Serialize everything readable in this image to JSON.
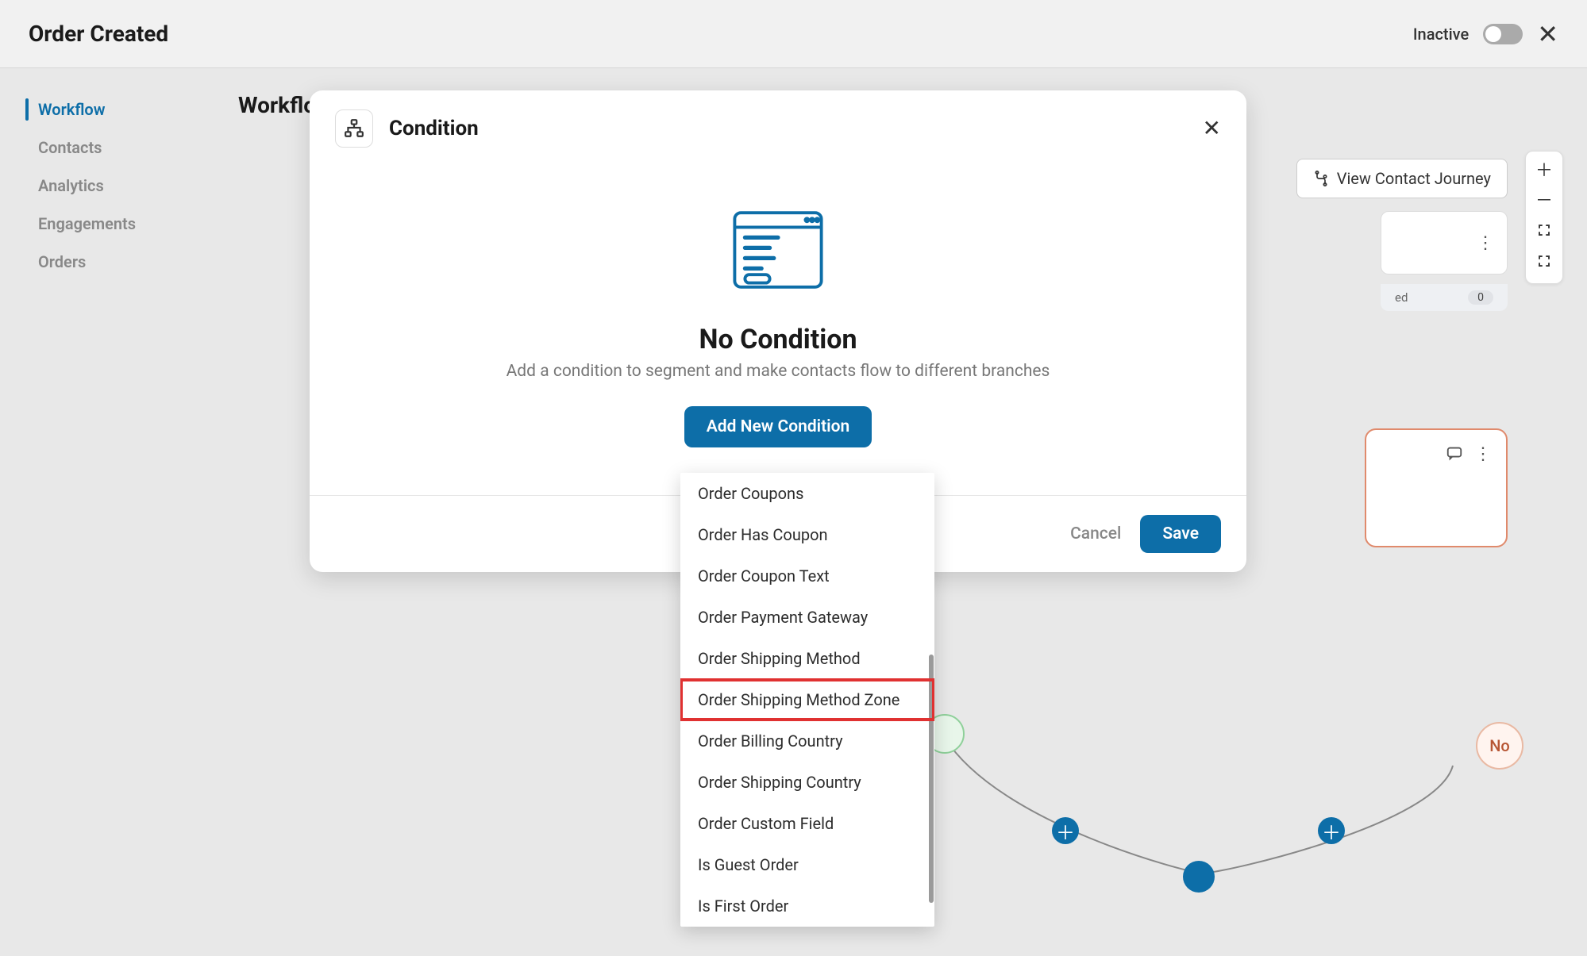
{
  "header": {
    "title": "Order Created",
    "status": "Inactive"
  },
  "sidebar": {
    "items": [
      {
        "label": "Workflow",
        "active": true
      },
      {
        "label": "Contacts",
        "active": false
      },
      {
        "label": "Analytics",
        "active": false
      },
      {
        "label": "Engagements",
        "active": false
      },
      {
        "label": "Orders",
        "active": false
      }
    ]
  },
  "content": {
    "title": "Workflow",
    "journey_button": "View Contact Journey"
  },
  "background": {
    "badge_label": "ed",
    "badge_count": "0",
    "node_no": "No"
  },
  "modal": {
    "title": "Condition",
    "empty_title": "No Condition",
    "empty_sub": "Add a condition to segment and make contacts flow to different branches",
    "add_button": "Add New Condition",
    "cancel": "Cancel",
    "save": "Save"
  },
  "dropdown": {
    "items": [
      "Order Coupons",
      "Order Has Coupon",
      "Order Coupon Text",
      "Order Payment Gateway",
      "Order Shipping Method",
      "Order Shipping Method Zone",
      "Order Billing Country",
      "Order Shipping Country",
      "Order Custom Field",
      "Is Guest Order",
      "Is First Order"
    ],
    "highlighted_index": 5
  }
}
